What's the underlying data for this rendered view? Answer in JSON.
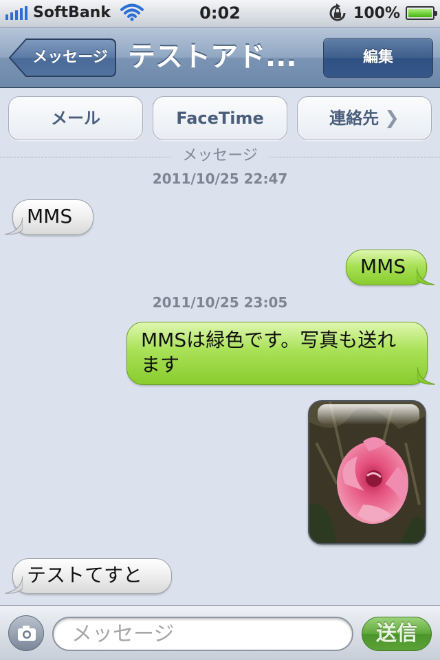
{
  "status_bar": {
    "carrier": "SoftBank",
    "time": "0:02",
    "battery_percent": "100%",
    "signal_bars": 5,
    "icons": [
      "signal-icon",
      "wifi-icon",
      "rotation-lock-icon",
      "battery-icon"
    ]
  },
  "nav": {
    "back_label": "メッセージ",
    "title": "テストアド...",
    "edit_label": "編集"
  },
  "actions": {
    "mail_label": "メール",
    "facetime_label": "FaceTime",
    "contact_label": "連絡先",
    "contact_icon": "chevron-right-icon"
  },
  "conversation": {
    "section_label": "メッセージ",
    "timestamps": [
      "2011/10/25 22:47",
      "2011/10/25 23:05"
    ],
    "messages": [
      {
        "direction": "incoming",
        "text": "MMS"
      },
      {
        "direction": "outgoing",
        "text": "MMS"
      },
      {
        "direction": "outgoing",
        "text": "MMSは緑色です。写真も送れます"
      },
      {
        "direction": "outgoing",
        "type": "photo",
        "subject": "pink rose"
      },
      {
        "direction": "incoming",
        "text": "テストてすと"
      }
    ],
    "colors": {
      "outgoing_bubble": "#a9e157",
      "incoming_bubble": "#f0f0f0",
      "background": "#dbe2ed"
    }
  },
  "composer": {
    "camera_icon": "camera-icon",
    "placeholder": "メッセージ",
    "send_label": "送信"
  }
}
